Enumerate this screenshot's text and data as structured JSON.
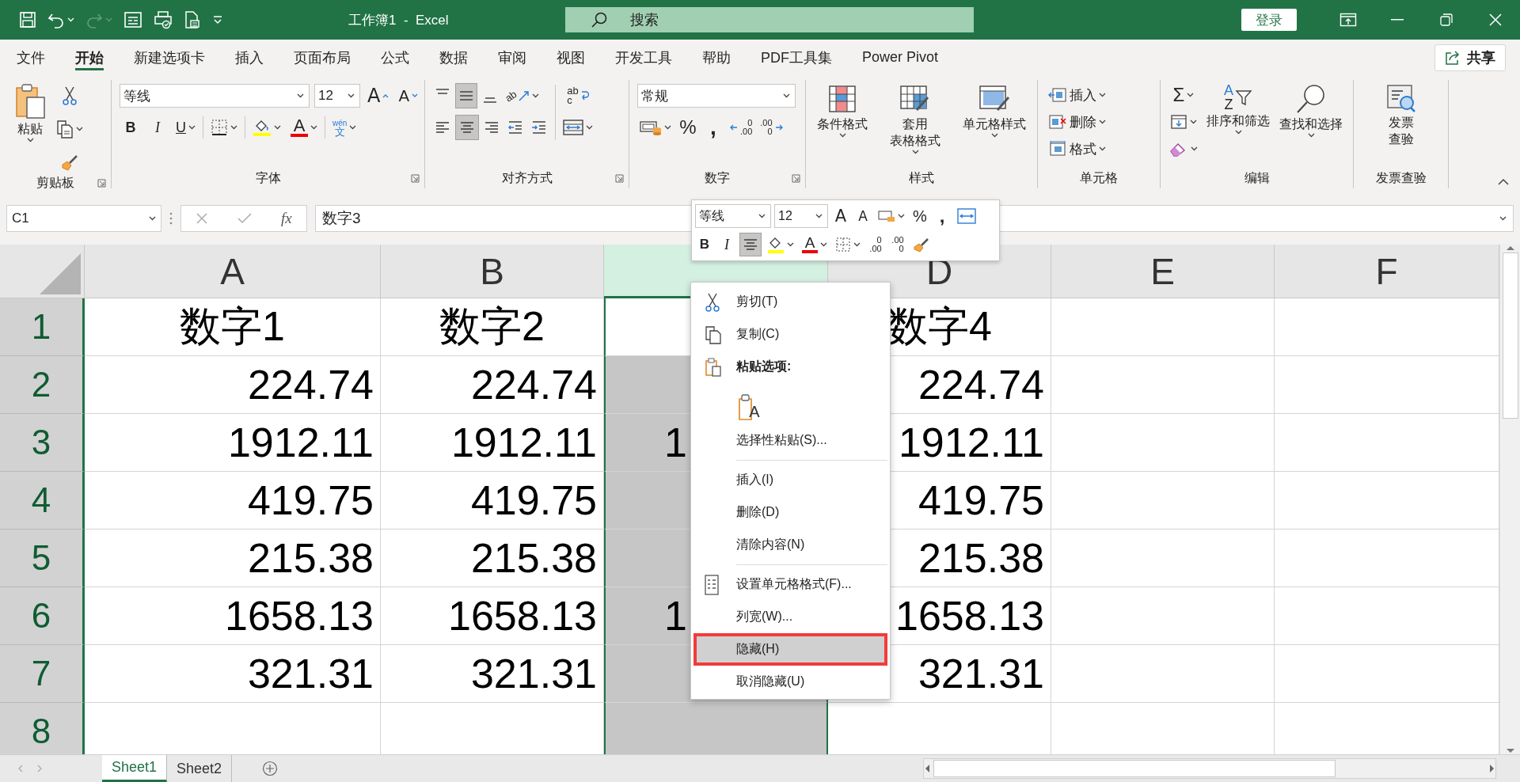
{
  "title_bar": {
    "title": "工作簿1  -  Excel",
    "search_placeholder": "搜索",
    "sign_in": "登录"
  },
  "tabs": [
    {
      "label": "文件",
      "selected": false
    },
    {
      "label": "开始",
      "selected": true
    },
    {
      "label": "新建选项卡",
      "selected": false
    },
    {
      "label": "插入",
      "selected": false
    },
    {
      "label": "页面布局",
      "selected": false
    },
    {
      "label": "公式",
      "selected": false
    },
    {
      "label": "数据",
      "selected": false
    },
    {
      "label": "审阅",
      "selected": false
    },
    {
      "label": "视图",
      "selected": false
    },
    {
      "label": "开发工具",
      "selected": false
    },
    {
      "label": "帮助",
      "selected": false
    },
    {
      "label": "PDF工具集",
      "selected": false
    },
    {
      "label": "Power Pivot",
      "selected": false
    }
  ],
  "share": "共享",
  "ribbon": {
    "clipboard": {
      "label": "剪贴板",
      "paste": "粘贴"
    },
    "font": {
      "label": "字体",
      "font_name": "等线",
      "font_size": "12",
      "grow": "A",
      "shrink": "A",
      "bold": "B",
      "italic": "I",
      "underline": "U",
      "font_color": "A",
      "phonetic_top": "wén",
      "phonetic_bottom": "文"
    },
    "alignment": {
      "label": "对齐方式",
      "vertical_align": [
        {
          "selected": false
        },
        {
          "selected": true
        },
        {
          "selected": false
        }
      ],
      "orientation": "ab",
      "horizontal_align": [
        {
          "selected": false
        },
        {
          "selected": true
        },
        {
          "selected": false
        }
      ],
      "wrap_top": "ab",
      "wrap_bottom": "c"
    },
    "number": {
      "label": "数字",
      "format": "常规",
      "percent": "%",
      "comma": ",",
      "increase_decimal": [
        "0",
        ".00"
      ],
      "decrease_decimal": [
        ".00",
        "0"
      ]
    },
    "styles": {
      "label": "样式",
      "buttons": [
        [
          "条件格式"
        ],
        [
          "套用",
          "表格格式"
        ],
        [
          "单元格样式"
        ]
      ]
    },
    "cells": {
      "label": "单元格",
      "buttons": [
        "插入",
        "删除",
        "格式"
      ]
    },
    "editing": {
      "label": "编辑",
      "sum": "Σ",
      "sort_letters": [
        "A",
        "Z"
      ],
      "sort": "排序和筛选",
      "find": "查找和选择"
    },
    "invoice": {
      "label": "发票查验",
      "button": [
        "发票",
        "查验"
      ]
    }
  },
  "formula_bar": {
    "name_box": "C1",
    "fx": "fx",
    "value": "数字3"
  },
  "grid": {
    "columns": [
      {
        "label": "A",
        "selected": false,
        "covered": false
      },
      {
        "label": "B",
        "selected": false,
        "covered": false
      },
      {
        "selected": true,
        "covered": true
      },
      {
        "label": "D",
        "selected": false,
        "covered": false
      },
      {
        "label": "E",
        "selected": false,
        "covered": false
      },
      {
        "label": "F",
        "selected": false,
        "covered": false
      }
    ],
    "rows": [
      {
        "header": "1",
        "active": true,
        "cells": [
          "数字1",
          "数字2",
          null,
          "数字4",
          null,
          null
        ]
      },
      {
        "header": "2",
        "active": false,
        "cells": [
          "224.74",
          "224.74",
          null,
          "224.74",
          null,
          null
        ]
      },
      {
        "header": "3",
        "active": false,
        "cells": [
          "1912.11",
          "1912.11",
          "1",
          "1912.11",
          null,
          null
        ]
      },
      {
        "header": "4",
        "active": false,
        "cells": [
          "419.75",
          "419.75",
          null,
          "419.75",
          null,
          null
        ]
      },
      {
        "header": "5",
        "active": false,
        "cells": [
          "215.38",
          "215.38",
          null,
          "215.38",
          null,
          null
        ]
      },
      {
        "header": "6",
        "active": false,
        "cells": [
          "1658.13",
          "1658.13",
          "1",
          "1658.13",
          null,
          null
        ]
      },
      {
        "header": "7",
        "active": false,
        "cells": [
          "321.31",
          "321.31",
          null,
          "321.31",
          null,
          null
        ]
      },
      {
        "header": "8",
        "active": false,
        "cells": [
          null,
          null,
          null,
          null,
          null,
          null
        ]
      }
    ]
  },
  "sheets": [
    {
      "label": "Sheet1",
      "selected": true
    },
    {
      "label": "Sheet2",
      "selected": false
    }
  ],
  "mini_toolbar": {
    "font_name": "等线",
    "font_size": "12",
    "grow": "A",
    "shrink": "A",
    "percent": "%",
    "comma": ",",
    "bold": "B",
    "italic": "I",
    "center_selected": true,
    "font_color": "A",
    "increase_decimal": [
      "0",
      ".00"
    ],
    "decrease_decimal": [
      ".00",
      "0"
    ]
  },
  "context_menu": [
    {
      "kind": "cut",
      "label": "剪切(T)",
      "selected": false
    },
    {
      "kind": "copy",
      "label": "复制(C)",
      "selected": false
    },
    {
      "kind": "heading",
      "label": "粘贴选项:",
      "selected": false
    },
    {
      "kind": "paste",
      "label": "A"
    },
    {
      "kind": "plain",
      "label": "选择性粘贴(S)...",
      "selected": false
    },
    {
      "kind": "separator"
    },
    {
      "kind": "plain",
      "label": "插入(I)",
      "selected": false
    },
    {
      "kind": "plain",
      "label": "删除(D)",
      "selected": false
    },
    {
      "kind": "plain",
      "label": "清除内容(N)",
      "selected": false
    },
    {
      "kind": "separator"
    },
    {
      "kind": "format",
      "label": "设置单元格格式(F)...",
      "selected": false
    },
    {
      "kind": "plain",
      "label": "列宽(W)...",
      "selected": false
    },
    {
      "kind": "plain",
      "label": "隐藏(H)",
      "selected": true
    },
    {
      "kind": "plain",
      "label": "取消隐藏(U)",
      "selected": false
    }
  ]
}
